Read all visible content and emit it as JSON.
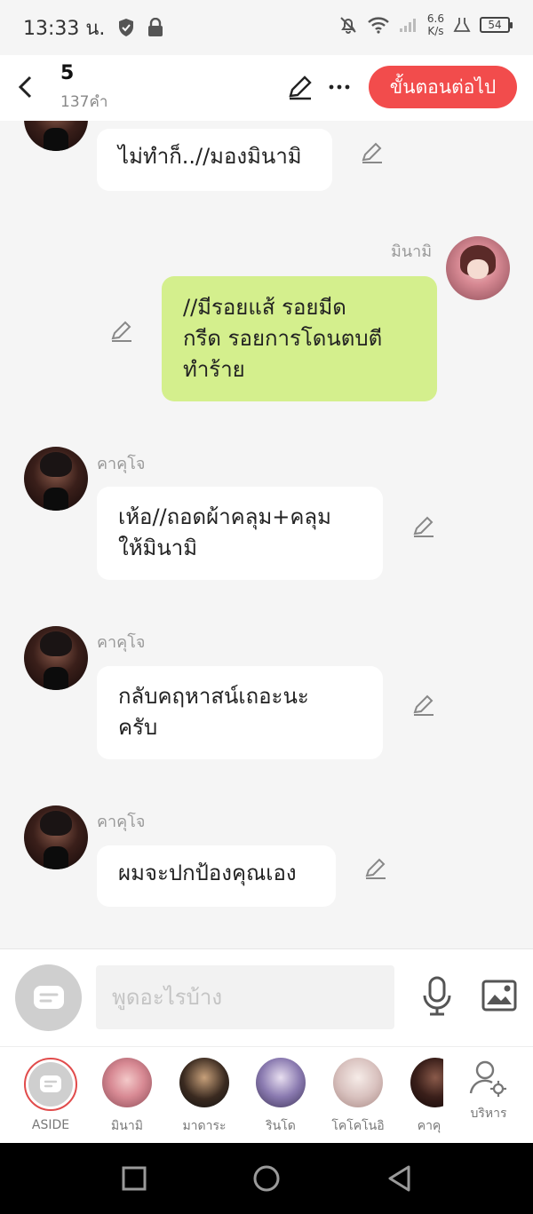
{
  "status_bar": {
    "time": "13:33 น.",
    "net_speed_value": "6.6",
    "net_speed_unit": "K/s",
    "battery": "54"
  },
  "header": {
    "title": "5",
    "word_count": "137คำ",
    "next_button": "ขั้นตอนต่อไป"
  },
  "messages": [
    {
      "sender": "",
      "text": "ไม่ทำก็..//มองมินามิ"
    },
    {
      "sender": "มินามิ",
      "text": "//มีรอยแส้ รอยมีด\nกรีด รอยการโดนตบตี\nทำร้าย"
    },
    {
      "sender": "คาคุโจ",
      "text": "เห้อ//ถอดผ้าคลุม+คลุม\nให้มินามิ"
    },
    {
      "sender": "คาคุโจ",
      "text": "กลับคฤหาสน์เถอะนะ\nครับ"
    },
    {
      "sender": "คาคุโจ",
      "text": "ผมจะปกป้องคุณเอง"
    }
  ],
  "input": {
    "placeholder": "พูดอะไรบ้าง"
  },
  "characters": [
    {
      "label": "ASIDE"
    },
    {
      "label": "มินามิ"
    },
    {
      "label": "มาดาระ"
    },
    {
      "label": "รินโด"
    },
    {
      "label": "โคโคโนอิ"
    },
    {
      "label": "คาคุ"
    }
  ],
  "manage_label": "บริหาร",
  "colors": {
    "accent": "#f24c4c",
    "my_bubble": "#d4ef8d",
    "other_bubble": "#ffffff"
  }
}
